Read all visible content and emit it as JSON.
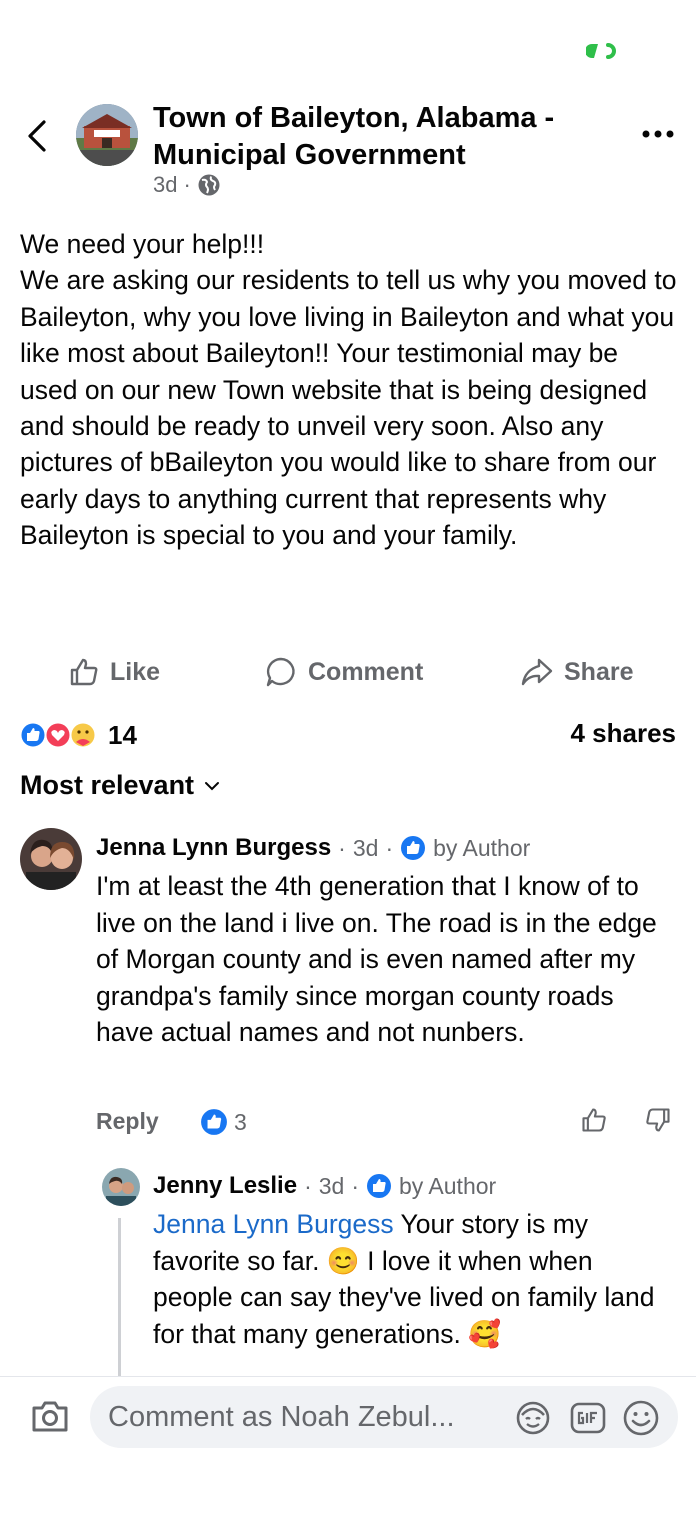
{
  "status_bar": {
    "battery_color": "#2fbf4a"
  },
  "header": {
    "page_name": "Town of Baileyton, Alabama - Municipal Government",
    "time": "3d",
    "dot": "·",
    "audience_icon": "globe-icon"
  },
  "post": {
    "text": "We need your help!!!\nWe are asking our residents to tell us why you moved to Baileyton, why you love living in Baileyton and what you like most about Baileyton!! Your testimonial may be used on our new Town website that is being designed and should be ready to unveil very soon. Also any pictures of bBaileyton you would like to share from our early days to anything current that represents why Baileyton is special to you and your family."
  },
  "actions": {
    "like": "Like",
    "comment": "Comment",
    "share": "Share"
  },
  "stats": {
    "reaction_count": "14",
    "shares": "4 shares"
  },
  "sort": {
    "label": "Most relevant"
  },
  "comments": [
    {
      "name": "Jenna Lynn Burgess",
      "time": "3d",
      "dot": "·",
      "badge": "by Author",
      "text": "I'm at least the 4th generation that I know of to live on the land i live on. The road is in the edge of Morgan county and is even named after my grandpa's family since morgan county roads have actual names and not nunbers.",
      "reply_label": "Reply",
      "like_count": "3"
    },
    {
      "name": "Jenny Leslie",
      "time": "3d",
      "dot": "·",
      "badge": "by Author",
      "mention": "Jenna Lynn Burgess",
      "text_part1": " Your story is my favorite so far. ",
      "emoji1": "😊",
      "text_part2": " I love it when when people can say they've lived on family land for that many generations. ",
      "emoji2": "🥰"
    }
  ],
  "composer": {
    "placeholder": "Comment as Noah Zebul..."
  },
  "colors": {
    "facebook_blue": "#1877f2",
    "secondary_text": "#65676b",
    "love_red": "#f33e58"
  }
}
